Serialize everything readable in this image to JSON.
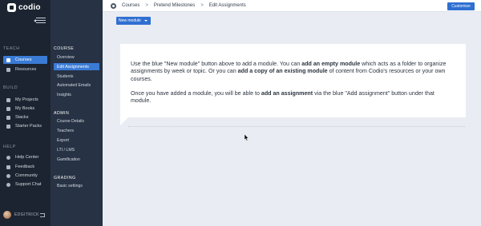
{
  "brand": {
    "name": "codio"
  },
  "sidebar": {
    "teach_title": "TEACH",
    "teach_items": [
      {
        "label": "Courses",
        "icon": "graduation-cap-icon"
      },
      {
        "label": "Resources",
        "icon": "folder-icon"
      }
    ],
    "build_title": "BUILD",
    "build_items": [
      {
        "label": "My Projects",
        "icon": "code-icon"
      },
      {
        "label": "My Books",
        "icon": "book-icon"
      },
      {
        "label": "Stacks",
        "icon": "stack-icon"
      },
      {
        "label": "Starter Packs",
        "icon": "package-icon"
      }
    ],
    "help_title": "HELP",
    "help_items": [
      {
        "label": "Help Center",
        "icon": "question-icon"
      },
      {
        "label": "Feedback",
        "icon": "megaphone-icon"
      },
      {
        "label": "Community",
        "icon": "community-icon"
      },
      {
        "label": "Support Chat",
        "icon": "chat-icon"
      }
    ],
    "username": "EDGITRICK"
  },
  "subnav": {
    "course_title": "COURSE",
    "course_items": [
      "Overview",
      "Edit Assignments",
      "Students",
      "Automated Emails",
      "Insights"
    ],
    "admin_title": "ADMIN",
    "admin_items": [
      "Course Details",
      "Teachers",
      "Export",
      "LTI / LMS",
      "Gamification"
    ],
    "grading_title": "GRADING",
    "grading_items": [
      "Basic settings"
    ]
  },
  "breadcrumb": {
    "items": [
      "Courses",
      "Pretend Milestones",
      "Edit Assignments"
    ],
    "separator": ">"
  },
  "actions": {
    "customize_label": "Customize",
    "new_module_label": "New module"
  },
  "card": {
    "p1_a": "Use the blue \"New module\" button above to add a module. You can ",
    "p1_b": "add an empty module",
    "p1_c": " which acts as a folder to organize assignments by week or topic. Or you can ",
    "p1_d": "add a copy of an existing module",
    "p1_e": " of content from Codio's resources or your own courses.",
    "p2_a": "Once you have added a module, you will be able to ",
    "p2_b": "add an assignment",
    "p2_c": " via the blue \"Add assignment\" button under that module."
  },
  "colors": {
    "accent": "#3a7bd5",
    "button": "#2f6fd1",
    "sidebar": "#1b2430",
    "subnav": "#273244"
  }
}
